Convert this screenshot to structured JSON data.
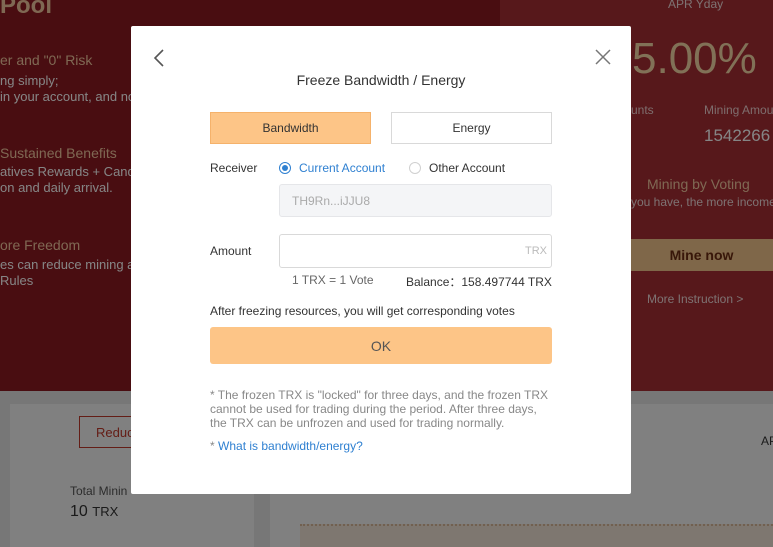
{
  "background": {
    "pool_title": "Pool",
    "feature1": {
      "title": "er and \"0\" Risk",
      "line1": "ng simply;",
      "line2": " in your account, and no"
    },
    "feature2": {
      "title": "Sustained Benefits",
      "line1": "atives Rewards + Candid",
      "line2": "on and daily arrival."
    },
    "feature3": {
      "title": "ore Freedom",
      "line1": "es can reduce mining an",
      "line2": "Rules"
    },
    "apr_label": "APR Yday",
    "apr_value": "5.00%",
    "accounts_label": "unts",
    "mining_amount_label": "Mining Amou",
    "mining_amount_value": "1542266",
    "mining_by_voting": "Mining by Voting",
    "voting_desc": " you have, the more income",
    "mine_now": "Mine now",
    "more_instruction": "More Instruction >",
    "reduce_btn": "Reduc",
    "total_mining_label": "Total Minin",
    "total_mining_value": "10",
    "total_mining_unit": "TRX",
    "apr_short": "AP"
  },
  "modal": {
    "title": "Freeze Bandwidth / Energy",
    "tabs": {
      "bandwidth": "Bandwidth",
      "energy": "Energy"
    },
    "receiver_label": "Receiver",
    "radio_current": "Current Account",
    "radio_other": "Other Account",
    "address": "TH9Rn...iJJU8",
    "amount_label": "Amount",
    "amount_value": "",
    "amount_unit": "TRX",
    "rate": "1 TRX = 1 Vote",
    "balance_label": "Balance：",
    "balance_value": "158.497744 TRX",
    "votes_info": "After freezing resources, you will get corresponding votes",
    "ok_label": "OK",
    "note": "* The frozen TRX is \"locked\" for three days, and the frozen TRX cannot be used for trading during the period. After three days, the TRX can be unfrozen and used for trading normally.",
    "help_star": "* ",
    "help_link": "What is bandwidth/energy?"
  },
  "colors": {
    "accent": "#fdc587",
    "link": "#2f80d1",
    "hero": "#8d1a22"
  }
}
